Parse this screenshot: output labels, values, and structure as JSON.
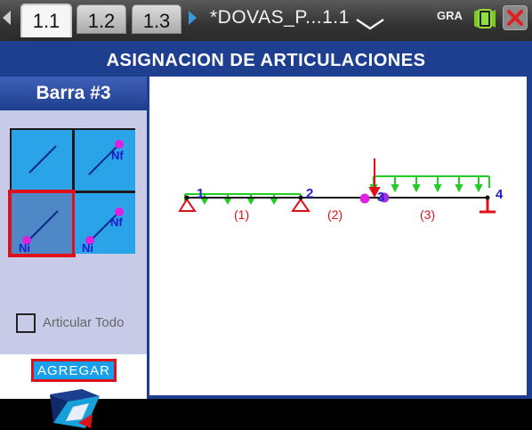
{
  "tabs": [
    {
      "label": "1.1",
      "active": true
    },
    {
      "label": "1.2",
      "active": false
    },
    {
      "label": "1.3",
      "active": false
    }
  ],
  "document_title": "*DOVAS_P...1.1",
  "status": {
    "mode": "GRA"
  },
  "app_title": "ASIGNACION DE ARTICULACIONES",
  "sidebar": {
    "header": "Barra #3",
    "options": [
      {
        "labels": [],
        "selected": false
      },
      {
        "labels": [
          "Nf"
        ],
        "selected": false
      },
      {
        "labels": [
          "Ni"
        ],
        "selected": true
      },
      {
        "labels": [
          "Nf",
          "Ni"
        ],
        "selected": false
      }
    ],
    "checkbox_label": "Articular Todo",
    "checkbox_checked": false,
    "add_button": "AGREGAR"
  },
  "beam": {
    "nodes": [
      "1",
      "2",
      "3",
      "4"
    ],
    "members": [
      "(1)",
      "(2)",
      "(3)"
    ]
  },
  "colors": {
    "load": "#22cc22",
    "support": "#e0101a",
    "hinge": "#e020e0",
    "node_label": "#2222cc",
    "member_label": "#e0101a",
    "accent": "#1aa0ea"
  }
}
